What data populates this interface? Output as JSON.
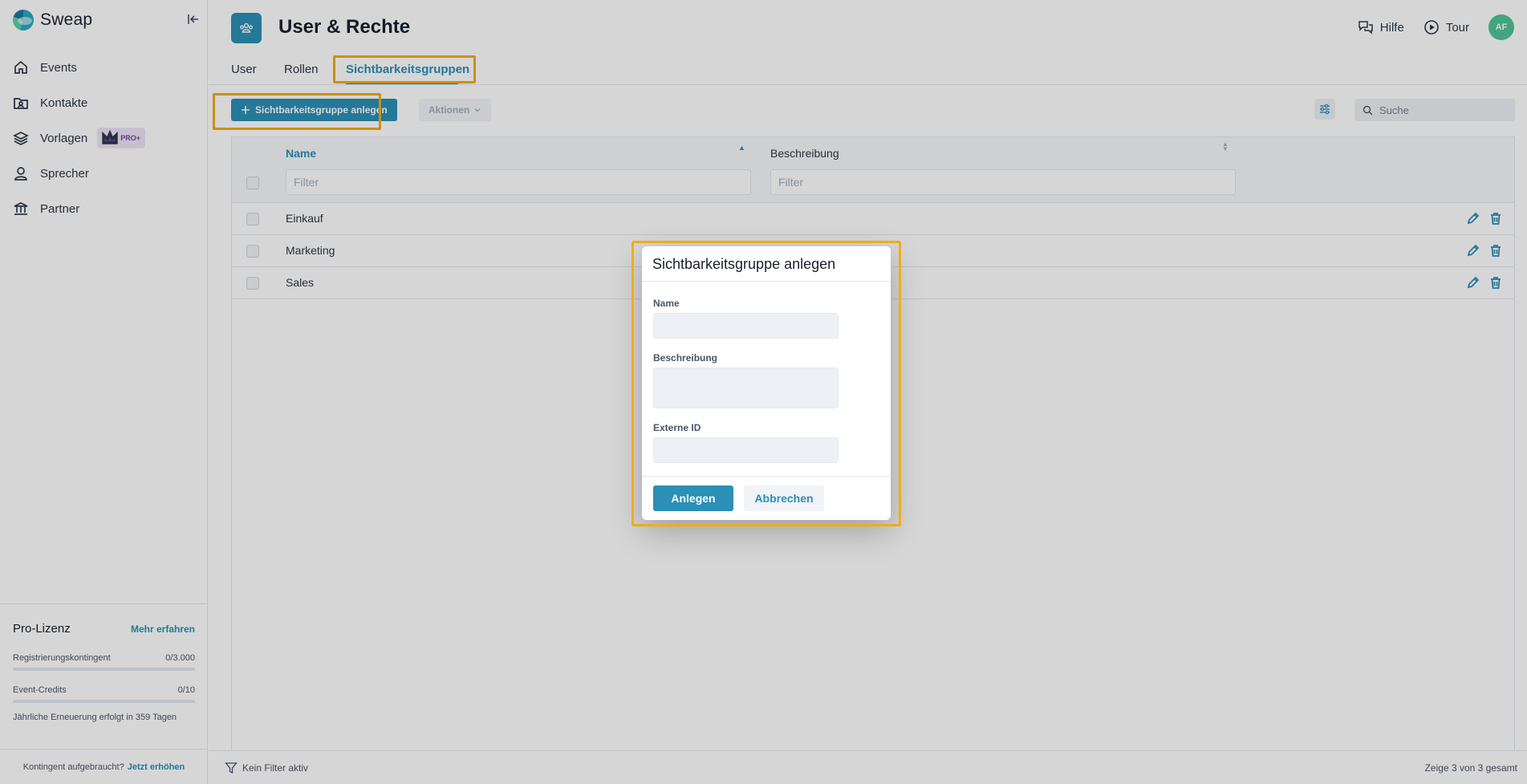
{
  "brand": {
    "name": "Sweap"
  },
  "sidebar": {
    "items": [
      {
        "label": "Events",
        "icon": "home-icon"
      },
      {
        "label": "Kontakte",
        "icon": "contacts-icon"
      },
      {
        "label": "Vorlagen",
        "icon": "layers-icon",
        "badge": "PRO+"
      },
      {
        "label": "Sprecher",
        "icon": "speaker-icon"
      },
      {
        "label": "Partner",
        "icon": "bank-icon"
      }
    ]
  },
  "license": {
    "title": "Pro-Lizenz",
    "more_label": "Mehr erfahren",
    "registrations_label": "Registrierungskontingent",
    "registrations_value": "0/3.000",
    "registrations_progress": 0,
    "credits_label": "Event-Credits",
    "credits_value": "0/10",
    "credits_progress": 0,
    "renewal_text": "Jährliche Erneuerung erfolgt in 359 Tagen",
    "footer_text": "Kontingent aufgebraucht?",
    "footer_link": "Jetzt erhöhen"
  },
  "header": {
    "title": "User & Rechte",
    "help_label": "Hilfe",
    "tour_label": "Tour",
    "avatar_initials": "AF"
  },
  "tabs": [
    {
      "label": "User",
      "active": false
    },
    {
      "label": "Rollen",
      "active": false
    },
    {
      "label": "Sichtbarkeitsgruppen",
      "active": true
    }
  ],
  "toolbar": {
    "add_label": "Sichtbarkeitsgruppe anlegen",
    "actions_label": "Aktionen",
    "search_placeholder": "Suche"
  },
  "table": {
    "columns": [
      "Name",
      "Beschreibung"
    ],
    "filter_placeholder": "Filter",
    "rows": [
      {
        "name": "Einkauf",
        "description": ""
      },
      {
        "name": "Marketing",
        "description": ""
      },
      {
        "name": "Sales",
        "description": ""
      }
    ]
  },
  "footer": {
    "filter_status": "Kein Filter aktiv",
    "count_text": "Zeige 3 von 3 gesamt"
  },
  "dialog": {
    "title": "Sichtbarkeitsgruppe anlegen",
    "name_label": "Name",
    "name_value": "",
    "description_label": "Beschreibung",
    "description_value": "",
    "external_id_label": "Externe ID",
    "external_id_value": "",
    "create_label": "Anlegen",
    "cancel_label": "Abbrechen"
  },
  "colors": {
    "accent": "#2b8fb6",
    "highlight": "#f0ad19",
    "avatar": "#4fc49a",
    "pro_badge": "#ede4f7"
  }
}
